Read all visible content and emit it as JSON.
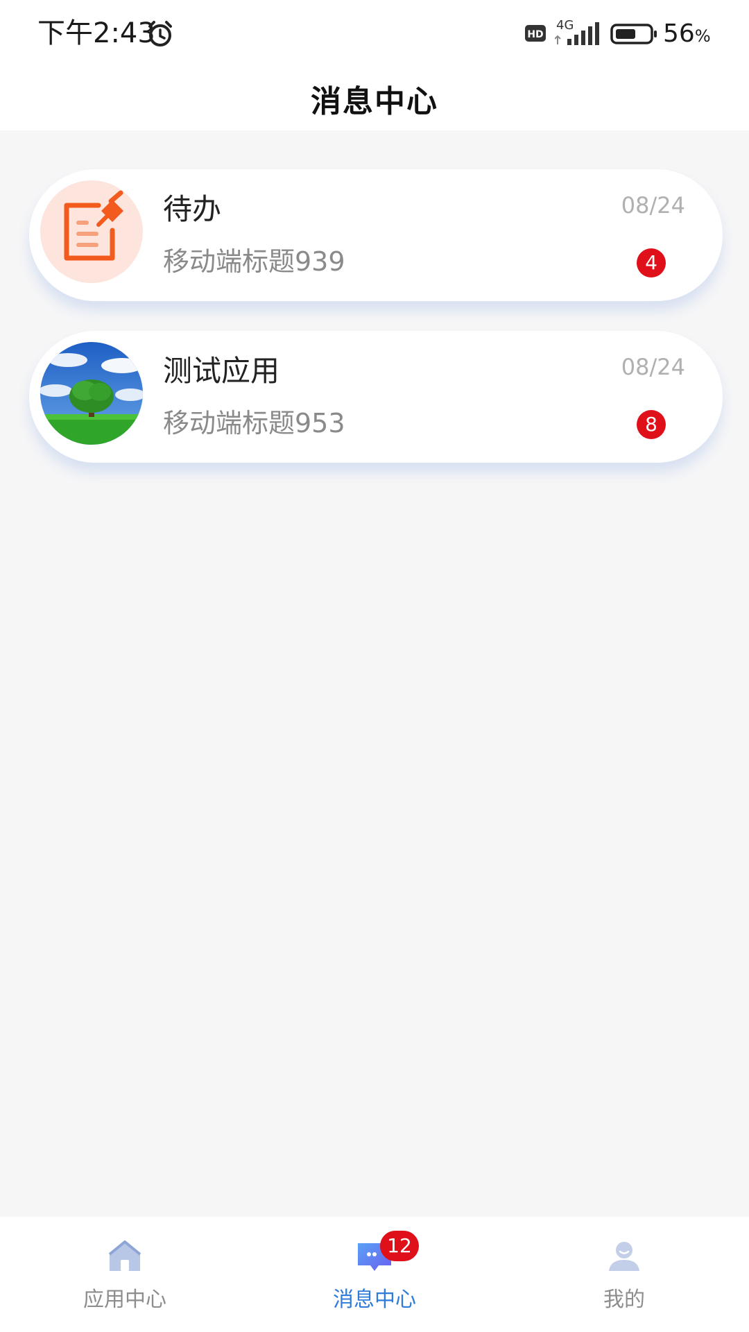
{
  "status_bar": {
    "time": "下午2:43",
    "network": "4G",
    "battery_level": "56",
    "battery_unit": "%",
    "icons": [
      "alarm-icon",
      "hd-icon",
      "signal-icon",
      "battery-icon"
    ]
  },
  "header": {
    "title": "消息中心"
  },
  "messages": [
    {
      "title": "待办",
      "subtitle": "移动端标题939",
      "date": "08/24",
      "count": "4",
      "avatar": "todo-document-pin-icon"
    },
    {
      "title": "测试应用",
      "subtitle": "移动端标题953",
      "date": "08/24",
      "count": "8",
      "avatar": "tree-landscape-image"
    }
  ],
  "tabs": [
    {
      "label": "应用中心",
      "icon": "home-icon",
      "active": false
    },
    {
      "label": "消息中心",
      "icon": "message-icon",
      "active": true,
      "badge": "12"
    },
    {
      "label": "我的",
      "icon": "user-icon",
      "active": false
    }
  ],
  "colors": {
    "accent": "#2e7bd8",
    "badge": "#e0101a",
    "background": "#f6f6f7",
    "todo_icon": "#f25a1e"
  }
}
